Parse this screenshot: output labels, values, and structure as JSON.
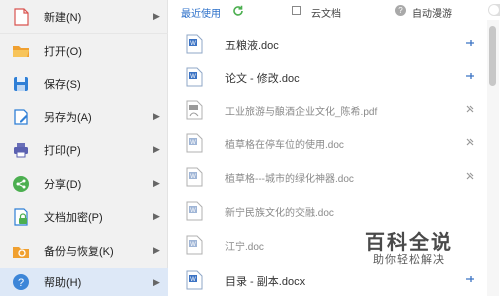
{
  "menu": {
    "items": [
      {
        "label": "新建(N)",
        "icon": "new-file-icon",
        "has_submenu": true
      },
      {
        "label": "打开(O)",
        "icon": "folder-open-icon",
        "has_submenu": false
      },
      {
        "label": "保存(S)",
        "icon": "save-icon",
        "has_submenu": false
      },
      {
        "label": "另存为(A)",
        "icon": "save-as-icon",
        "has_submenu": true
      },
      {
        "label": "打印(P)",
        "icon": "print-icon",
        "has_submenu": true
      },
      {
        "label": "分享(D)",
        "icon": "share-icon",
        "has_submenu": true
      },
      {
        "label": "文档加密(P)",
        "icon": "lock-document-icon",
        "has_submenu": true
      },
      {
        "label": "备份与恢复(K)",
        "icon": "backup-icon",
        "has_submenu": true
      },
      {
        "label": "帮助(H)",
        "icon": "help-icon",
        "has_submenu": true,
        "active": true
      }
    ],
    "arrow_glyph": "▶"
  },
  "recent": {
    "title": "最近使用",
    "cloud_label": "云文档",
    "roam_label": "自动漫游",
    "files": [
      {
        "name": "五粮液.doc",
        "type": "word",
        "pinned": true
      },
      {
        "name": "论文 - 修改.doc",
        "type": "word",
        "pinned": true
      },
      {
        "name": "工业旅游与酿酒企业文化_陈希.pdf",
        "type": "pdf",
        "pinned": false
      },
      {
        "name": "植草格在停车位的使用.doc",
        "type": "word",
        "pinned": false
      },
      {
        "name": "植草格---城市的绿化神器.doc",
        "type": "word",
        "pinned": false
      },
      {
        "name": "新宁民族文化的交融.doc",
        "type": "word",
        "pinned": false
      },
      {
        "name": "江宁.doc",
        "type": "word",
        "pinned": false
      },
      {
        "name": "目录 - 副本.docx",
        "type": "word",
        "pinned": true
      }
    ]
  },
  "watermark": {
    "title": "百科全说",
    "subtitle": "助你轻松解决"
  },
  "colors": {
    "accent": "#2b6fc9",
    "menu_bg": "#f1f1f1",
    "active_bg": "#dde8f7"
  }
}
